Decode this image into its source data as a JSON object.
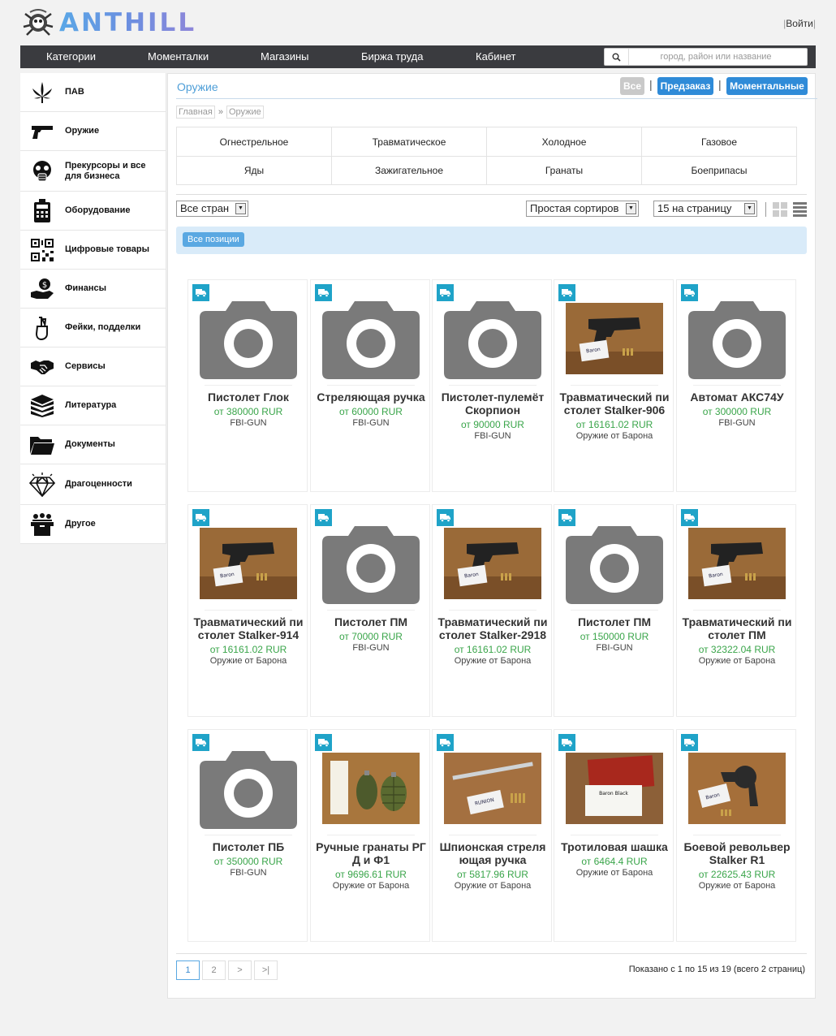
{
  "header": {
    "logo_text": "ANTHILL",
    "login": "Войти"
  },
  "nav": {
    "items": [
      "Категории",
      "Моменталки",
      "Магазины",
      "Биржа труда",
      "Кабинет"
    ],
    "search_placeholder": "город, район или название"
  },
  "sidebar": {
    "items": [
      {
        "label": "ПАВ",
        "icon": "cannabis-leaf-icon"
      },
      {
        "label": "Оружие",
        "icon": "pistol-icon"
      },
      {
        "label": "Прекурсоры и все для бизнеса",
        "icon": "gas-mask-icon"
      },
      {
        "label": "Оборудование",
        "icon": "scale-icon"
      },
      {
        "label": "Цифровые товары",
        "icon": "qr-code-icon"
      },
      {
        "label": "Финансы",
        "icon": "money-hand-icon"
      },
      {
        "label": "Фейки, подделки",
        "icon": "crossed-fingers-icon"
      },
      {
        "label": "Сервисы",
        "icon": "handshake-icon"
      },
      {
        "label": "Литература",
        "icon": "books-icon"
      },
      {
        "label": "Документы",
        "icon": "folder-icon"
      },
      {
        "label": "Драгоценности",
        "icon": "diamond-icon"
      },
      {
        "label": "Другое",
        "icon": "box-icon"
      }
    ]
  },
  "main": {
    "title": "Оружие",
    "filters": {
      "all": "Все",
      "preorder": "Предзаказ",
      "instant": "Моментальные"
    },
    "breadcrumb": {
      "home": "Главная",
      "sep": "»",
      "current": "Оружие"
    },
    "subcategories": [
      [
        "Огнестрельное",
        "Травматическое",
        "Холодное",
        "Газовое"
      ],
      [
        "Яды",
        "Зажигательное",
        "Гранаты",
        "Боеприпасы"
      ]
    ],
    "country_select": "Все стран",
    "sort_select": "Простая сортиров",
    "per_page_select": "15 на страницу",
    "all_positions": "Все позиции"
  },
  "products": [
    {
      "name": "Пистолет Глок",
      "price": "от 380000 RUR",
      "shop": "FBI-GUN",
      "image": "placeholder-camera"
    },
    {
      "name": "Стреляющая ручка",
      "price": "от 60000 RUR",
      "shop": "FBI-GUN",
      "image": "placeholder-camera"
    },
    {
      "name": "Пистолет-пулемёт Скорпион",
      "price": "от 90000 RUR",
      "shop": "FBI-GUN",
      "image": "placeholder-camera"
    },
    {
      "name": "Травматический пистолет Stalker-906",
      "price": "от 16161.02 RUR",
      "shop": "Оружие от Барона",
      "image": "photo-pistol"
    },
    {
      "name": "Автомат АКС74У",
      "price": "от 300000 RUR",
      "shop": "FBI-GUN",
      "image": "placeholder-camera"
    },
    {
      "name": "Травматический пистолет Stalker-914",
      "price": "от 16161.02 RUR",
      "shop": "Оружие от Барона",
      "image": "photo-pistol"
    },
    {
      "name": "Пистолет ПМ",
      "price": "от 70000 RUR",
      "shop": "FBI-GUN",
      "image": "placeholder-camera"
    },
    {
      "name": "Травматический пистолет Stalker-2918",
      "price": "от 16161.02 RUR",
      "shop": "Оружие от Барона",
      "image": "photo-pistol"
    },
    {
      "name": "Пистолет ПМ",
      "price": "от 150000 RUR",
      "shop": "FBI-GUN",
      "image": "placeholder-camera"
    },
    {
      "name": "Травматический пистолет ПМ",
      "price": "от 32322.04 RUR",
      "shop": "Оружие от Барона",
      "image": "photo-pistol"
    },
    {
      "name": "Пистолет ПБ",
      "price": "от 350000 RUR",
      "shop": "FBI-GUN",
      "image": "placeholder-camera"
    },
    {
      "name": "Ручные гранаты РГД и Ф1",
      "price": "от 9696.61 RUR",
      "shop": "Оружие от Барона",
      "image": "photo-grenades"
    },
    {
      "name": "Шпионская стреляющая ручка",
      "price": "от 5817.96 RUR",
      "shop": "Оружие от Барона",
      "image": "photo-pen"
    },
    {
      "name": "Тротиловая шашка",
      "price": "от 6464.4 RUR",
      "shop": "Оружие от Барона",
      "image": "photo-tnt"
    },
    {
      "name": "Боевой револьвер Stalker R1",
      "price": "от 22625.43 RUR",
      "shop": "Оружие от Барона",
      "image": "photo-revolver"
    }
  ],
  "pagination": {
    "pages": [
      "1",
      "2",
      ">",
      ">|"
    ],
    "summary": "Показано с 1 по 15 из 19 (всего 2 страниц)"
  }
}
